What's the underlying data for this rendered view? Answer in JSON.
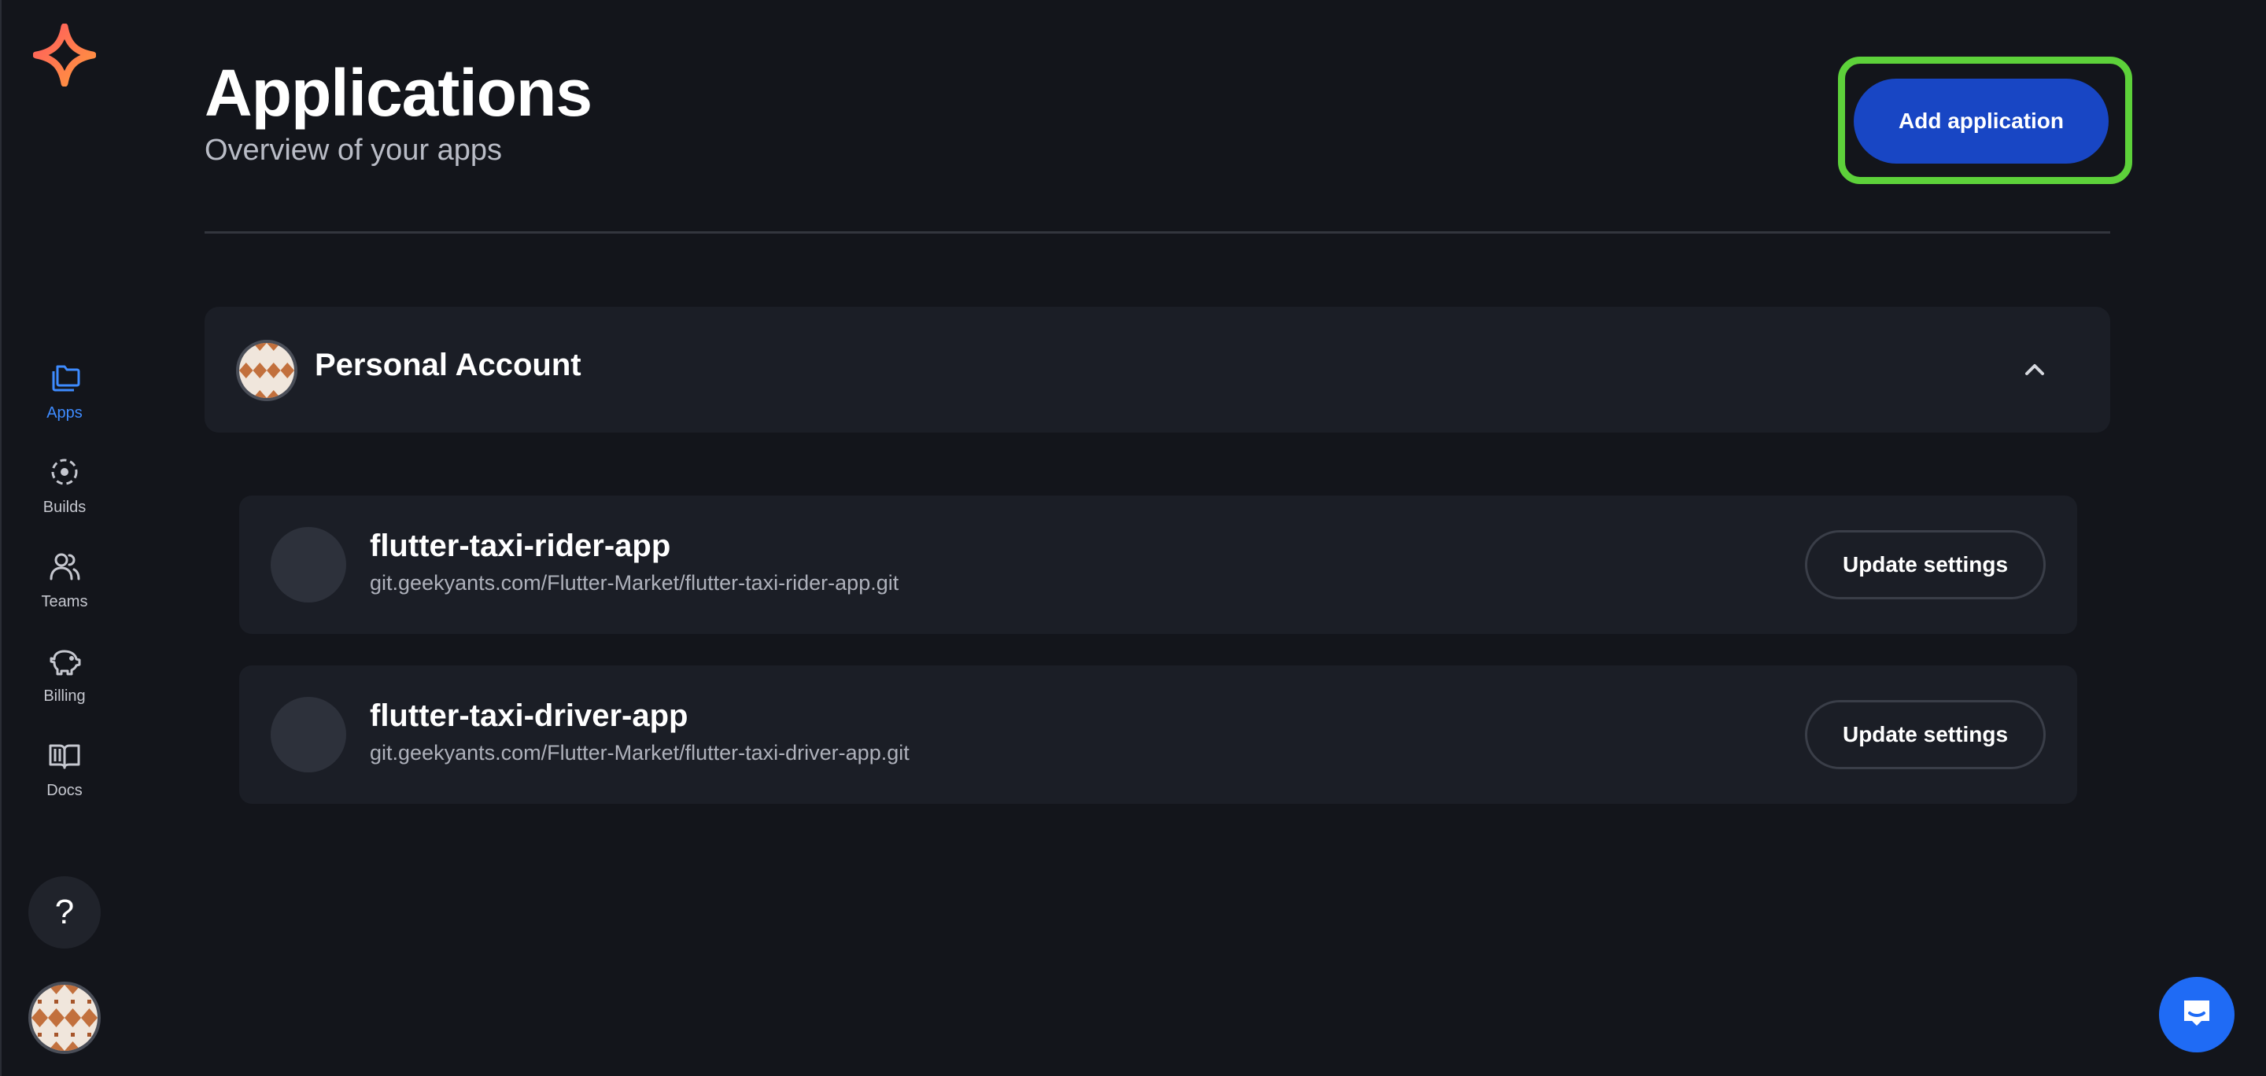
{
  "sidebar": {
    "logo_icon": "star-logo-icon",
    "items": [
      {
        "label": "Apps",
        "icon": "folder-icon",
        "active": true
      },
      {
        "label": "Builds",
        "icon": "builds-icon",
        "active": false
      },
      {
        "label": "Teams",
        "icon": "team-icon",
        "active": false
      },
      {
        "label": "Billing",
        "icon": "piggy-bank-icon",
        "active": false
      },
      {
        "label": "Docs",
        "icon": "book-icon",
        "active": false
      }
    ],
    "help_label": "?"
  },
  "header": {
    "title": "Applications",
    "subtitle": "Overview of your apps",
    "add_button_label": "Add application"
  },
  "account": {
    "name": "Personal Account",
    "expanded": true
  },
  "apps": [
    {
      "name": "flutter-taxi-rider-app",
      "repo": "git.geekyants.com/Flutter-Market/flutter-taxi-rider-app.git",
      "button_label": "Update settings"
    },
    {
      "name": "flutter-taxi-driver-app",
      "repo": "git.geekyants.com/Flutter-Market/flutter-taxi-driver-app.git",
      "button_label": "Update settings"
    }
  ],
  "colors": {
    "background": "#13151b",
    "card": "#1b1e26",
    "primary": "#1846c4",
    "active_nav": "#3e8bff",
    "highlight": "#5dd13a",
    "chat": "#1f6bf5"
  }
}
